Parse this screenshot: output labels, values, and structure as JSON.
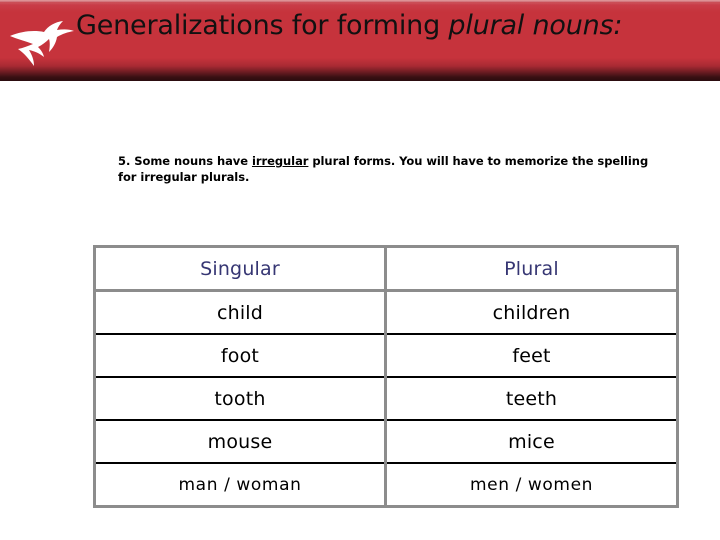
{
  "banner": {
    "title_plain": "Generalizations for forming ",
    "title_italic": "plural nouns:",
    "icon": "bird-swallow-icon",
    "background_color": "#c6333c",
    "edge_color": "#2a0c0f"
  },
  "note": {
    "number": "5.",
    "lead": "  Some nouns have ",
    "emphasis": "irregular",
    "rest": " plural forms.  You will have to memorize the spelling for irregular plurals."
  },
  "table": {
    "border_color": "#8c8c8c",
    "row_rule_color": "#000000",
    "header_text_color": "#363673",
    "columns": [
      "Singular",
      "Plural"
    ],
    "rows": [
      {
        "singular": "child",
        "plural": "children"
      },
      {
        "singular": "foot",
        "plural": "feet"
      },
      {
        "singular": "tooth",
        "plural": "teeth"
      },
      {
        "singular": "mouse",
        "plural": "mice"
      },
      {
        "singular": "man / woman",
        "plural": "men / women"
      }
    ]
  }
}
